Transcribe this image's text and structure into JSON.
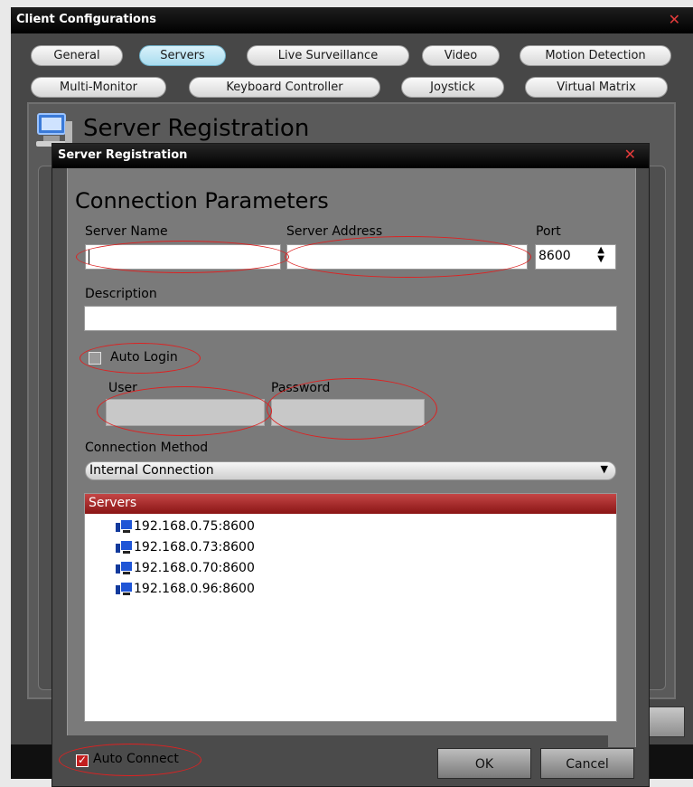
{
  "outer": {
    "title": "Client Configurations",
    "tabs_row1": [
      "General",
      "Servers",
      "Live Surveillance",
      "Video",
      "Motion Detection"
    ],
    "tabs_row2": [
      "Multi-Monitor",
      "Keyboard Controller",
      "Joystick",
      "Virtual Matrix"
    ],
    "active_tab": "Servers",
    "heading": "Server Registration"
  },
  "dialog": {
    "title": "Server Registration",
    "heading": "Connection Parameters",
    "server_name": {
      "label": "Server Name",
      "value": ""
    },
    "server_address": {
      "label": "Server Address",
      "value": ""
    },
    "port": {
      "label": "Port",
      "value": "8600"
    },
    "description": {
      "label": "Description",
      "value": ""
    },
    "auto_login": {
      "label": "Auto Login",
      "checked": false
    },
    "user": {
      "label": "User",
      "value": ""
    },
    "password": {
      "label": "Password",
      "value": ""
    },
    "connection_method": {
      "label": "Connection Method",
      "value": "Internal Connection"
    },
    "servers": {
      "header": "Servers",
      "items": [
        "192.168.0.75:8600",
        "192.168.0.73:8600",
        "192.168.0.70:8600",
        "192.168.0.96:8600"
      ]
    },
    "auto_connect": {
      "label": "Auto Connect",
      "checked": true
    },
    "ok_label": "OK",
    "cancel_label": "Cancel"
  },
  "colors": {
    "list_header": "#a32a2a",
    "annotation": "#d22222",
    "active_tab": "#a9dcef"
  }
}
